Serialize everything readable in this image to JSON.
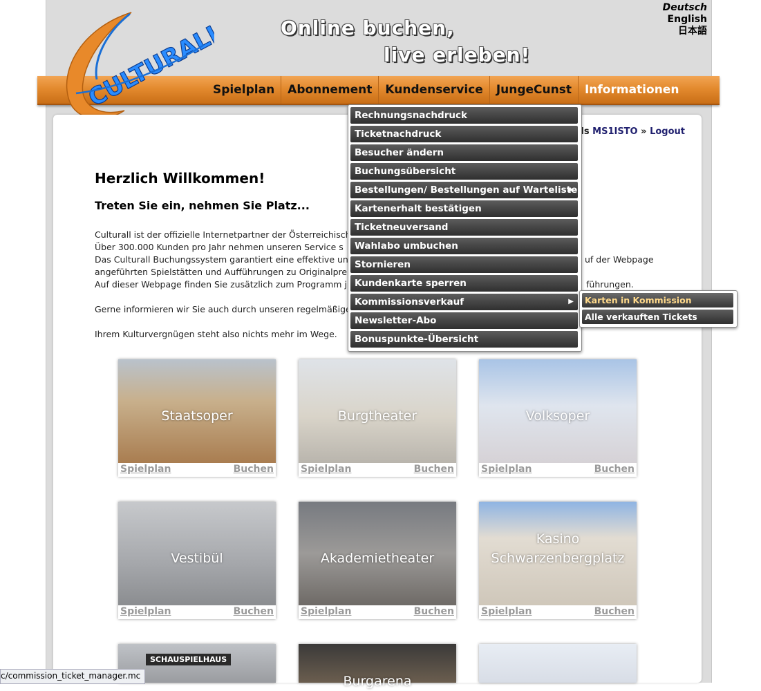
{
  "languages": [
    "Deutsch",
    "English",
    "日本語"
  ],
  "slogan": {
    "line1": "Online buchen,",
    "line2": "live erleben!"
  },
  "logo": {
    "text": "CULTURALL"
  },
  "nav": [
    "Spielplan",
    "Abonnement",
    "Kundenservice",
    "JungeCunst",
    "Informationen"
  ],
  "login": {
    "prefix": "gt als",
    "user": "MS1ISTO",
    "sep": "»",
    "logout": "Logout"
  },
  "welcome": {
    "title": "Herzlich Willkommen!",
    "subtitle": "Treten Sie ein, nehmen Sie Platz..."
  },
  "paragraphs": {
    "p1_l1_left": "Culturall ist der offizielle Internetpartner der Österreichisch",
    "p1_l2_left": "Über 300.000 Kunden pro Jahr nehmen unseren Service s",
    "p1_l3_left": "Das Culturall Buchungssystem garantiert eine effektive un",
    "p1_l3_right": "uf der Webpage",
    "p1_l4_left": "angeführten Spielstätten und Aufführungen zu Originalpre",
    "p1_l5_left": "Auf dieser Webpage finden Sie zusätzlich zum Programm j",
    "p1_l5_right": "führungen.",
    "p2_left": "Gerne informieren wir Sie auch durch unseren regelmäßige",
    "p3": "Ihrem Kulturvergnügen steht also nichts mehr im Wege."
  },
  "dropdown": [
    "Rechnungsnachdruck",
    "Ticketnachdruck",
    "Besucher ändern",
    "Buchungsübersicht",
    "Bestellungen/ Bestellungen auf Warteliste",
    "Kartenerhalt bestätigen",
    "Ticketneuversand",
    "Wahlabo umbuchen",
    "Stornieren",
    "Kundenkarte sperren",
    "Kommissionsverkauf",
    "Newsletter-Abo",
    "Bonuspunkte-Übersicht"
  ],
  "submenu": [
    "Karten in Kommission verkaufen",
    "Alle verkauften Tickets"
  ],
  "venues": [
    {
      "name": "Staatsoper",
      "link1": "Spielplan",
      "link2": "Buchen"
    },
    {
      "name": "Burgtheater",
      "link1": "Spielplan",
      "link2": "Buchen"
    },
    {
      "name": "Volksoper",
      "link1": "Spielplan",
      "link2": "Buchen"
    },
    {
      "name": "Vestibül",
      "link1": "Spielplan",
      "link2": "Buchen"
    },
    {
      "name": "Akademietheater",
      "link1": "Spielplan",
      "link2": "Buchen"
    },
    {
      "name": "Kasino Schwarzenbergplatz",
      "link1": "Spielplan",
      "link2": "Buchen"
    },
    {
      "name": "",
      "sign": "SCHAUSPIELHAUS"
    },
    {
      "name": "Burgarena"
    },
    {
      "name": ""
    }
  ],
  "status_url": "c/commission_ticket_manager.mc",
  "colors": {
    "nav_orange": "#e38a2e",
    "menu_dark": "#3a3a3a",
    "link_grey": "#9a9a9a",
    "user_blue": "#1f1f6e"
  }
}
